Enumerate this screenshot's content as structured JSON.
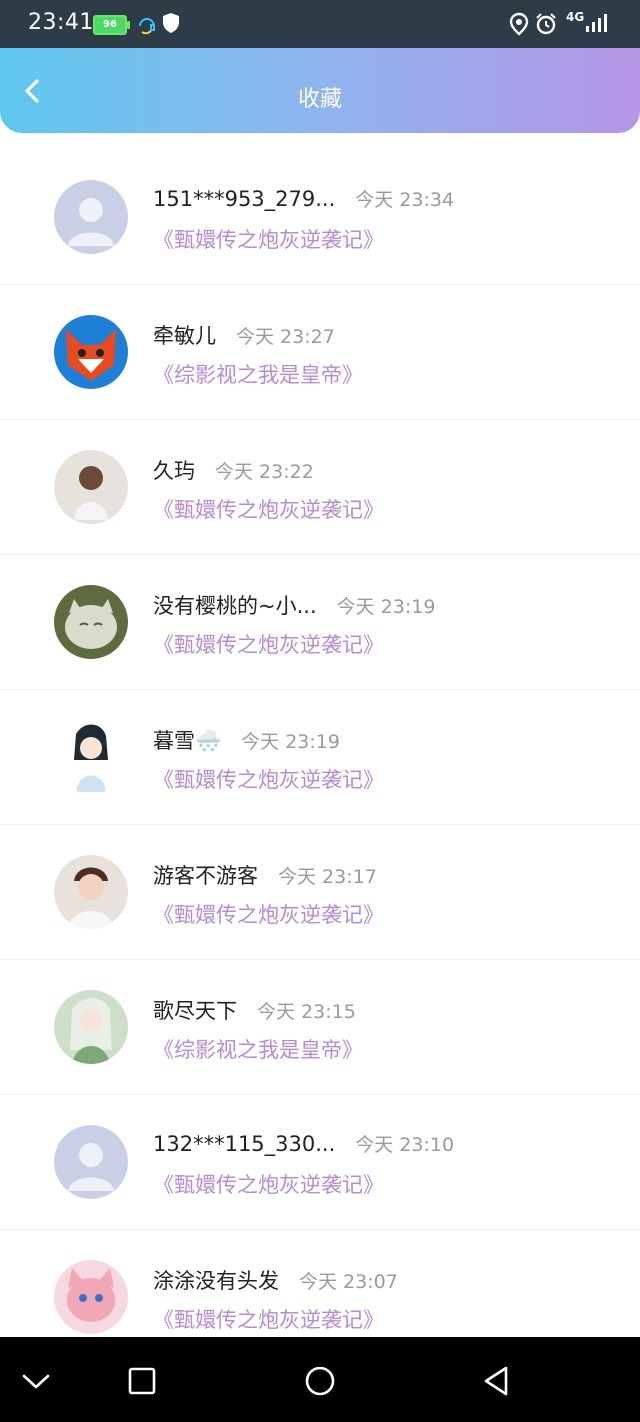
{
  "status_bar": {
    "time": "23:41",
    "battery": "96",
    "network": "4G"
  },
  "header": {
    "title": "收藏"
  },
  "items": [
    {
      "name": "151***953_279...",
      "time": "今天 23:34",
      "book": "《甄嬛传之炮灰逆袭记》",
      "avatar_color": "#c9d0e6"
    },
    {
      "name": "牵敏儿",
      "time": "今天 23:27",
      "book": "《综影视之我是皇帝》",
      "avatar_color": "#e94a1f"
    },
    {
      "name": "久玙",
      "time": "今天 23:22",
      "book": "《甄嬛传之炮灰逆袭记》",
      "avatar_color": "#d8cfc6"
    },
    {
      "name": "没有樱桃的~小...",
      "time": "今天 23:19",
      "book": "《甄嬛传之炮灰逆袭记》",
      "avatar_color": "#8f9a6a"
    },
    {
      "name": "暮雪🌨️",
      "time": "今天 23:19",
      "book": "《甄嬛传之炮灰逆袭记》",
      "avatar_color": "#dfe9f0"
    },
    {
      "name": "游客不游客",
      "time": "今天 23:17",
      "book": "《甄嬛传之炮灰逆袭记》",
      "avatar_color": "#d6c4b7"
    },
    {
      "name": "歌尽天下",
      "time": "今天 23:15",
      "book": "《综影视之我是皇帝》",
      "avatar_color": "#a9c6a3"
    },
    {
      "name": "132***115_330...",
      "time": "今天 23:10",
      "book": "《甄嬛传之炮灰逆袭记》",
      "avatar_color": "#c9d0e6"
    },
    {
      "name": "涂涂没有头发",
      "time": "今天 23:07",
      "book": "《甄嬛传之炮灰逆袭记》",
      "avatar_color": "#f2a7b4"
    }
  ],
  "colors": {
    "accent": "#b88ad6",
    "header_left": "#5fc8f0",
    "header_right": "#b596e6"
  }
}
